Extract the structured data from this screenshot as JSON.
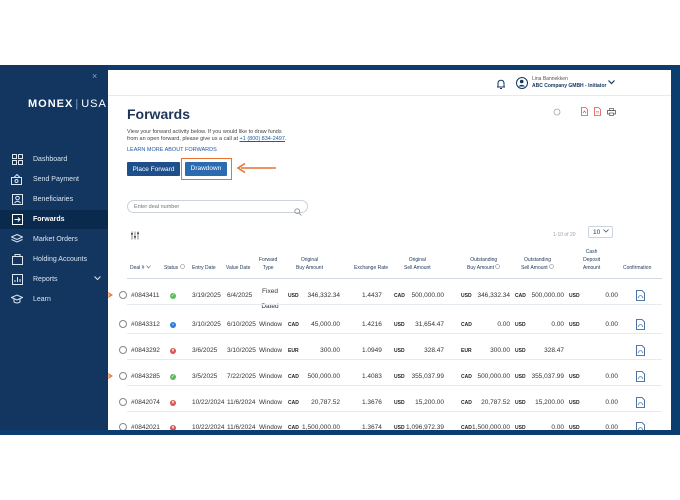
{
  "sidebar": {
    "close_label": "×",
    "logo_main": "MONEX",
    "logo_sep": "|",
    "logo_region": "USA",
    "items": [
      {
        "label": "Dashboard",
        "icon": "dashboard-icon"
      },
      {
        "label": "Send Payment",
        "icon": "send-payment-icon"
      },
      {
        "label": "Beneficiaries",
        "icon": "beneficiaries-icon"
      },
      {
        "label": "Forwards",
        "icon": "forwards-icon",
        "active": true
      },
      {
        "label": "Market Orders",
        "icon": "market-orders-icon"
      },
      {
        "label": "Holding Accounts",
        "icon": "holding-accounts-icon"
      },
      {
        "label": "Reports",
        "icon": "reports-icon",
        "expandable": true
      },
      {
        "label": "Learn",
        "icon": "learn-icon"
      }
    ]
  },
  "header": {
    "user_name": "Lina Bannekken",
    "company": "ABC Company GMBH - Initiator"
  },
  "page": {
    "title": "Forwards",
    "intro_line1": "View your forward activity below. If you would like to draw funds",
    "intro_line2_prefix": "from an open forward, please give us a call at",
    "phone": "+1 (800) 834-2497",
    "intro_line2_suffix": ".",
    "learn_more": "LEARN MORE ABOUT FORWARDS",
    "place_forward_label": "Place Forward",
    "drawdown_label": "Drawdown"
  },
  "search": {
    "placeholder": "Enter deal number"
  },
  "pagination": {
    "range": "1-10 of 20",
    "per_page": "10"
  },
  "colors": {
    "sidebar": "#12365f",
    "accent": "#e8722e",
    "primary_button": "#1e4f8a"
  },
  "table": {
    "headers": {
      "deal": "Deal #",
      "status": "Status",
      "entry_date": "Entry Date",
      "value_date": "Value Date",
      "forward_type": [
        "Forward",
        "Type"
      ],
      "original_buy": [
        "Original",
        "Buy Amount"
      ],
      "exchange_rate": "Exchange Rate",
      "original_sell": [
        "Original",
        "Sell Amount"
      ],
      "outstanding_buy": [
        "Outstanding",
        "Buy Amount"
      ],
      "outstanding_sell": [
        "Outstanding",
        "Sell Amount"
      ],
      "cash_deposit": [
        "Cash",
        "Deposit",
        "Amount"
      ],
      "confirmation": "Confirmation"
    },
    "rows": [
      {
        "deal": "#0843411",
        "status": "green",
        "entry": "3/19/2025",
        "value": "6/4/2025",
        "type": "Fixed Dated",
        "ob_cur": "USD",
        "ob_amt": "346,332.34",
        "rate": "1.4437",
        "os_cur": "CAD",
        "os_amt": "500,000.00",
        "outb_cur": "USD",
        "outb_amt": "346,332.34",
        "outs_cur": "CAD",
        "outs_amt": "500,000.00",
        "cd_cur": "USD",
        "cd_amt": "0.00"
      },
      {
        "deal": "#0843312",
        "status": "blue",
        "entry": "3/10/2025",
        "value": "6/10/2025",
        "type": "Window",
        "ob_cur": "CAD",
        "ob_amt": "45,000.00",
        "rate": "1.4216",
        "os_cur": "USD",
        "os_amt": "31,654.47",
        "outb_cur": "CAD",
        "outb_amt": "0.00",
        "outs_cur": "USD",
        "outs_amt": "0.00",
        "cd_cur": "USD",
        "cd_amt": "0.00"
      },
      {
        "deal": "#0843292",
        "status": "red",
        "entry": "3/6/2025",
        "value": "3/10/2025",
        "type": "Window",
        "ob_cur": "EUR",
        "ob_amt": "300.00",
        "rate": "1.0949",
        "os_cur": "USD",
        "os_amt": "328.47",
        "outb_cur": "EUR",
        "outb_amt": "300.00",
        "outs_cur": "USD",
        "outs_amt": "328.47",
        "cd_cur": "",
        "cd_amt": ""
      },
      {
        "deal": "#0843285",
        "status": "green",
        "entry": "3/5/2025",
        "value": "7/22/2025",
        "type": "Window",
        "ob_cur": "CAD",
        "ob_amt": "500,000.00",
        "rate": "1.4083",
        "os_cur": "USD",
        "os_amt": "355,037.99",
        "outb_cur": "CAD",
        "outb_amt": "500,000.00",
        "outs_cur": "USD",
        "outs_amt": "355,037.99",
        "cd_cur": "USD",
        "cd_amt": "0.00"
      },
      {
        "deal": "#0842074",
        "status": "red",
        "entry": "10/22/2024",
        "value": "11/6/2024",
        "type": "Window",
        "ob_cur": "CAD",
        "ob_amt": "20,787.52",
        "rate": "1.3676",
        "os_cur": "USD",
        "os_amt": "15,200.00",
        "outb_cur": "CAD",
        "outb_amt": "20,787.52",
        "outs_cur": "USD",
        "outs_amt": "15,200.00",
        "cd_cur": "USD",
        "cd_amt": "0.00"
      },
      {
        "deal": "#0842021",
        "status": "red",
        "entry": "10/22/2024",
        "value": "11/6/2024",
        "type": "Window",
        "ob_cur": "CAD",
        "ob_amt": "1,500,000.00",
        "rate": "1.3674",
        "os_cur": "USD",
        "os_amt": "1,096,972.39",
        "outb_cur": "CAD",
        "outb_amt": "1,500,000.00",
        "outs_cur": "USD",
        "outs_amt": "0.00",
        "cd_cur": "USD",
        "cd_amt": "0.00"
      }
    ]
  }
}
